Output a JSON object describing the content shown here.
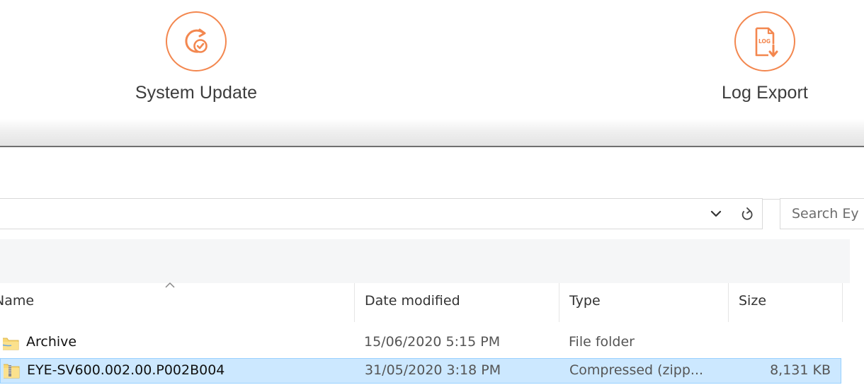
{
  "tiles": {
    "system_update": {
      "label": "System Update",
      "icon": "refresh-check-icon"
    },
    "log_export": {
      "label": "Log Export",
      "icon": "log-download-icon",
      "badge": "LOG"
    }
  },
  "colors": {
    "accent": "#f3874f",
    "selection_fill": "#cce8ff",
    "selection_border": "#99d1ff"
  },
  "explorer": {
    "search_placeholder": "Search Ey",
    "columns": {
      "name": "Name",
      "date": "Date modified",
      "type": "Type",
      "size": "Size"
    },
    "files": [
      {
        "name": "Archive",
        "date": "15/06/2020 5:15 PM",
        "type": "File folder",
        "size": "",
        "icon": "folder-icon",
        "selected": false
      },
      {
        "name": "EYE-SV600.002.00.P002B004",
        "date": "31/05/2020 3:18 PM",
        "type": "Compressed (zipp...",
        "size": "8,131 KB",
        "icon": "zip-folder-icon",
        "selected": true
      }
    ]
  }
}
